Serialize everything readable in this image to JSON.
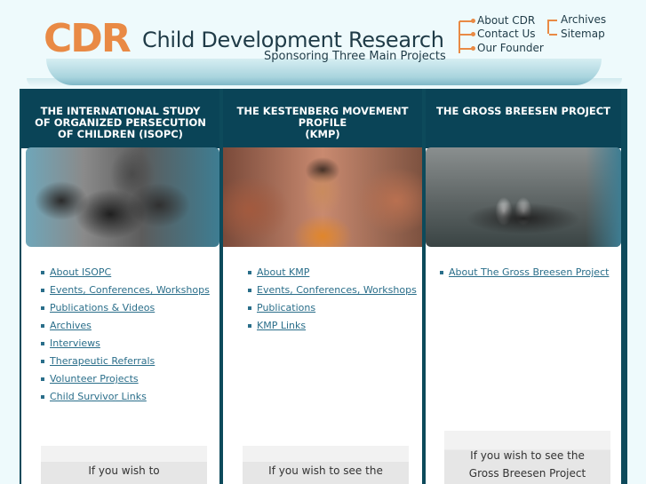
{
  "header": {
    "logo": "CDR",
    "title": "Child Development Research",
    "tagline": "Sponsoring Three Main Projects",
    "nav_primary": [
      "About CDR",
      "Contact Us",
      "Our Founder"
    ],
    "nav_secondary": [
      "Archives",
      "Sitemap"
    ],
    "accent_color": "#e98a45"
  },
  "columns": [
    {
      "heading": [
        "THE INTERNATIONAL STUDY",
        "OF ORGANIZED PERSECUTION",
        "OF CHILDREN (ISOPC)"
      ],
      "photo": "group-of-children-photo",
      "links": [
        "About ISOPC",
        "Events, Conferences, Workshops",
        "Publications & Videos",
        "Archives",
        "Interviews",
        "Therapeutic Referrals",
        "Volunteer Projects ",
        "Child Survivor Links"
      ],
      "wish": [
        "If you wish to"
      ]
    },
    {
      "heading": [
        "THE KESTENBERG MOVEMENT PROFILE",
        "(KMP)"
      ],
      "photo": "toddler-eating-photo",
      "links": [
        "About KMP",
        "Events, Conferences, Workshops",
        "Publications",
        "KMP Links"
      ],
      "wish": [
        "If you wish to see the"
      ]
    },
    {
      "heading": [
        "THE GROSS BREESEN PROJECT"
      ],
      "photo": "historic-group-photo",
      "links": [
        "About The Gross Breesen Project"
      ],
      "wish": [
        "If you wish to see the",
        "Gross Breesen Project"
      ]
    }
  ]
}
